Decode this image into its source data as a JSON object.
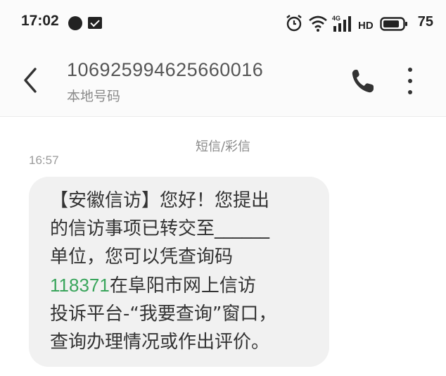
{
  "status_bar": {
    "time": "17:02",
    "battery": "75",
    "network": "4G"
  },
  "header": {
    "number": "106925994625660016",
    "subtitle": "本地号码"
  },
  "conversation": {
    "channel": "短信/彩信",
    "time": "16:57",
    "message": {
      "line1": "【安徽信访】您好！您提出",
      "line2": "的信访事项已转交至______",
      "line3": "单位，您可以凭查询码",
      "code": "118371",
      "line4_rest": "在阜阳市网上信访",
      "line5": "投诉平台-“我要查询”窗口，",
      "line6": "查询办理情况或作出评价。"
    }
  },
  "colors": {
    "link": "#3aa55c",
    "bubble": "#f1f1f1",
    "header_bg": "#fbfbfb"
  }
}
